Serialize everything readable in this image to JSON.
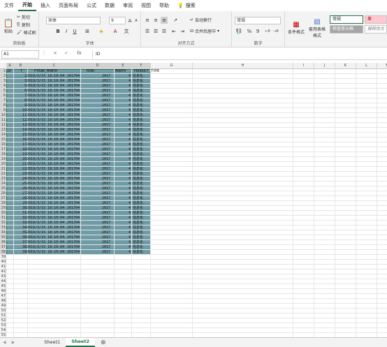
{
  "menu": {
    "items": [
      "文件",
      "开始",
      "插入",
      "页面布局",
      "公式",
      "数据",
      "审阅",
      "视图",
      "帮助"
    ],
    "active_index": 1,
    "search": "搜索"
  },
  "ribbon": {
    "clipboard": {
      "paste": "粘贴",
      "cut": "剪切",
      "copy": "复制",
      "format_painter": "格式刷",
      "label": "剪贴板"
    },
    "font": {
      "name": "宋体",
      "size": "9",
      "label": "字体",
      "bold": "B",
      "italic": "I",
      "underline": "U",
      "grow": "A",
      "shrink": "A"
    },
    "alignment": {
      "wrap": "自动换行",
      "merge": "合并后居中",
      "label": "对齐方式"
    },
    "number": {
      "format": "常规",
      "label": "数字",
      "percent": "%",
      "comma": "9"
    },
    "styles": {
      "conditional": "条件格式",
      "table": "套用表格格式",
      "normal": "常规",
      "bad": "差",
      "check_cell": "检查单元格",
      "explanatory": "解释性文"
    }
  },
  "formula_bar": {
    "name_box": "A1",
    "cancel": "×",
    "enter": "✓",
    "fx": "fx",
    "value": "ID"
  },
  "columns": [
    "A",
    "B",
    "C",
    "D",
    "E",
    "F",
    "G",
    "H",
    "I",
    "J",
    "K",
    "L",
    "M"
  ],
  "rows_visible": 55,
  "table": {
    "headers": [
      "ID",
      "T_",
      "FYEAR_MONTH",
      "YEAR",
      "MONTH",
      "PRODUCT_TYPE"
    ],
    "rows": [
      [
        "2",
        "2019/3/15 18:10:04",
        "201704",
        "2017",
        "4",
        "信息化"
      ],
      [
        "3",
        "2019/3/15 18:10:04",
        "201704",
        "2017",
        "4",
        "信息化"
      ],
      [
        "5",
        "2019/3/15 18:10:04",
        "201704",
        "2017",
        "4",
        "信息化"
      ],
      [
        "6",
        "2019/3/15 18:10:04",
        "201704",
        "2017",
        "4",
        "信息化"
      ],
      [
        "7",
        "2019/3/15 18:10:04",
        "201704",
        "2017",
        "4",
        "信息化"
      ],
      [
        "8",
        "2019/3/15 18:10:04",
        "201704",
        "2017",
        "4",
        "信息化"
      ],
      [
        "9",
        "2019/3/15 18:10:04",
        "201704",
        "2017",
        "4",
        "信息化"
      ],
      [
        "10",
        "2019/3/15 18:10:04",
        "201704",
        "2017",
        "4",
        "信息化"
      ],
      [
        "11",
        "2019/3/15 18:10:04",
        "201704",
        "2017",
        "4",
        "信息化"
      ],
      [
        "12",
        "2019/3/15 18:10:04",
        "201704",
        "2017",
        "4",
        "信息化"
      ],
      [
        "13",
        "2019/3/15 18:10:04",
        "201704",
        "2017",
        "4",
        "信息化"
      ],
      [
        "14",
        "2019/3/15 18:10:04",
        "201704",
        "2017",
        "4",
        "信息化"
      ],
      [
        "15",
        "2019/3/15 18:10:04",
        "201704",
        "2017",
        "4",
        "信息化"
      ],
      [
        "16",
        "2019/3/15 18:10:04",
        "201704",
        "2017",
        "4",
        "信息化"
      ],
      [
        "17",
        "2019/3/15 18:10:04",
        "201704",
        "2017",
        "4",
        "信息化"
      ],
      [
        "18",
        "2019/3/15 18:10:04",
        "201704",
        "2017",
        "4",
        "信息化"
      ],
      [
        "19",
        "2019/3/15 18:10:04",
        "201704",
        "2017",
        "4",
        "信息化"
      ],
      [
        "20",
        "2019/3/15 18:10:04",
        "201704",
        "2017",
        "4",
        "信息化"
      ],
      [
        "21",
        "2019/3/15 18:10:04",
        "201704",
        "2017",
        "4",
        "信息化"
      ],
      [
        "22",
        "2019/3/15 18:10:04",
        "201704",
        "2017",
        "4",
        "信息化"
      ],
      [
        "23",
        "2019/3/15 18:10:04",
        "201704",
        "2017",
        "4",
        "信息化"
      ],
      [
        "24",
        "2019/3/15 18:10:04",
        "201704",
        "2017",
        "4",
        "信息化"
      ],
      [
        "25",
        "2019/3/15 18:10:04",
        "201704",
        "2017",
        "4",
        "信息化"
      ],
      [
        "26",
        "2019/3/15 18:10:04",
        "201704",
        "2017",
        "4",
        "信息化"
      ],
      [
        "27",
        "2019/3/15 18:10:04",
        "201704",
        "2017",
        "4",
        "信息化"
      ],
      [
        "28",
        "2019/3/15 18:10:04",
        "201704",
        "2017",
        "4",
        "信息化"
      ],
      [
        "29",
        "2019/3/15 18:10:04",
        "201704",
        "2017",
        "4",
        "信息化"
      ],
      [
        "30",
        "2019/3/15 18:10:04",
        "201704",
        "2017",
        "4",
        "信息化"
      ],
      [
        "31",
        "2019/3/15 18:10:04",
        "201704",
        "2017",
        "4",
        "信息化"
      ],
      [
        "32",
        "2019/3/15 18:10:04",
        "201704",
        "2017",
        "4",
        "信息化"
      ],
      [
        "33",
        "2019/3/15 18:10:04",
        "201704",
        "2017",
        "4",
        "信息化"
      ],
      [
        "34",
        "2019/3/15 18:10:04",
        "201704",
        "2017",
        "4",
        "信息化"
      ],
      [
        "35",
        "2019/3/15 18:10:04",
        "201704",
        "2017",
        "4",
        "信息化"
      ],
      [
        "36",
        "2019/3/15 18:10:04",
        "201704",
        "2017",
        "4",
        "信息化"
      ],
      [
        "37",
        "2019/3/15 18:10:04",
        "201704",
        "2017",
        "4",
        "信息化"
      ],
      [
        "38",
        "2019/3/15 18:10:04",
        "201704",
        "2017",
        "4",
        "信息化"
      ],
      [
        "39",
        "2019/3/15 18:10:04",
        "201704",
        "2017",
        "4",
        "信息化"
      ]
    ]
  },
  "sheets": [
    "Sheet1",
    "Sheet2"
  ],
  "active_sheet": 1,
  "add_sheet": "⊕",
  "colors": {
    "accent": "#217346",
    "selection": "#6f9ba6",
    "bad_fill": "#ffc7ce",
    "bad_text": "#9c0006",
    "check_fill": "#a5a5a5"
  }
}
